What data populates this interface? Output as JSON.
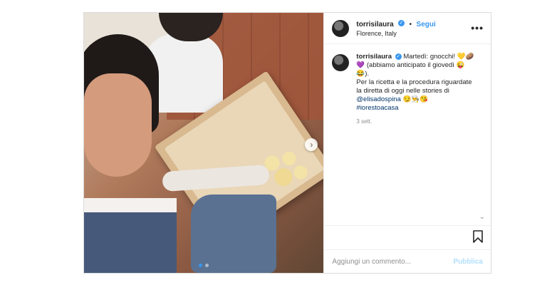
{
  "post": {
    "username": "torrisilaura",
    "separator": "•",
    "follow_label": "Segui",
    "location": "Florence, Italy",
    "more_label": "•••",
    "caption": {
      "username": "torrisilaura",
      "line1": "Martedì: gnocchi! 💛🥔",
      "line2": "💜 (abbiamo anticipato il giovedì 😜",
      "line3": "😂).",
      "line4": "Per la ricetta e la procedura riguardate",
      "line5": "la diretta di oggi nelle stories di",
      "mention": "@elisadospina",
      "mention_emojis": " 😏👨‍🍳😘",
      "hashtag": "#iorestoacasa"
    },
    "time_ago": "3 sett.",
    "comment_placeholder": "Aggiungi un commento...",
    "publish_label": "Pubblica",
    "carousel": {
      "total": 2,
      "current": 1
    },
    "colors": {
      "accent": "#3897f0",
      "publish_disabled": "#b2dffc",
      "muted": "#8e8e8e"
    }
  }
}
